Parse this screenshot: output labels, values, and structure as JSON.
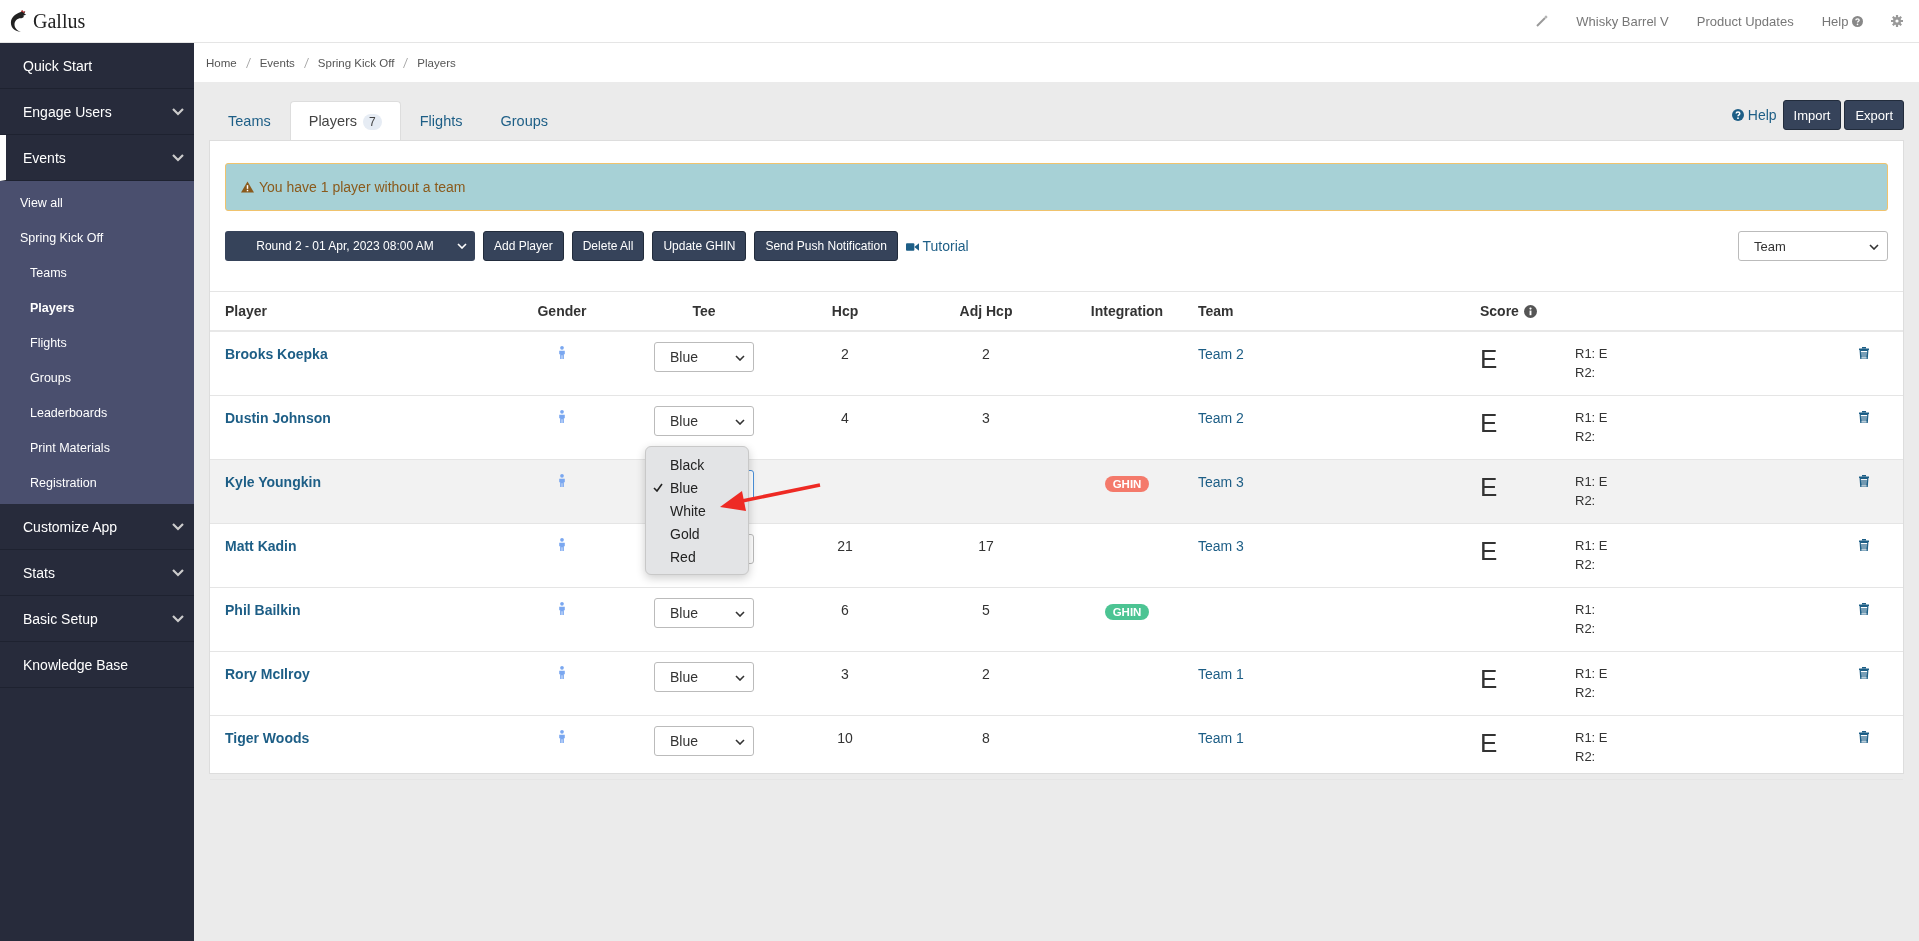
{
  "header": {
    "brand": "Gallus",
    "nav": [
      {
        "label": "Whisky Barrel V",
        "kind": "wand"
      },
      {
        "label": "Product Updates",
        "kind": "link"
      },
      {
        "label": "Help",
        "kind": "help"
      },
      {
        "kind": "settings"
      }
    ]
  },
  "sidebar": {
    "items": [
      {
        "label": "Quick Start",
        "kind": "link",
        "selected": false
      },
      {
        "label": "Engage Users",
        "kind": "group",
        "selected": false
      },
      {
        "label": "Events",
        "kind": "group",
        "selected": true,
        "children": [
          {
            "label": "View all",
            "selected": false
          },
          {
            "label": "Spring Kick Off",
            "selected": false,
            "children": [
              {
                "label": "Teams",
                "selected": false
              },
              {
                "label": "Players",
                "selected": true
              },
              {
                "label": "Flights",
                "selected": false
              },
              {
                "label": "Groups",
                "selected": false
              },
              {
                "label": "Leaderboards",
                "selected": false
              },
              {
                "label": "Print Materials",
                "selected": false
              },
              {
                "label": "Registration",
                "selected": false
              }
            ]
          }
        ]
      },
      {
        "label": "Customize App",
        "kind": "group",
        "selected": false
      },
      {
        "label": "Stats",
        "kind": "group",
        "selected": false
      },
      {
        "label": "Basic Setup",
        "kind": "group",
        "selected": false
      },
      {
        "label": "Knowledge Base",
        "kind": "link",
        "selected": false
      }
    ]
  },
  "breadcrumb": [
    "Home",
    "Events",
    "Spring Kick Off",
    "Players"
  ],
  "tabs": [
    {
      "label": "Teams",
      "selected": false
    },
    {
      "label": "Players",
      "count": "7",
      "selected": true
    },
    {
      "label": "Flights",
      "selected": false
    },
    {
      "label": "Groups",
      "selected": false
    }
  ],
  "actions": {
    "help": "Help",
    "buttons": [
      "Import",
      "Export"
    ]
  },
  "alert": "You have 1 player without a team",
  "toolbar": {
    "round_select": "Round 2 - 01 Apr, 2023 08:00 AM",
    "buttons": [
      "Add Player",
      "Delete All",
      "Update GHIN",
      "Send Push Notification"
    ],
    "tutorial": "Tutorial",
    "group_select": "Team"
  },
  "table": {
    "columns": [
      "Player",
      "Gender",
      "Tee",
      "Hcp",
      "Adj Hcp",
      "Integration",
      "Team",
      "Score"
    ],
    "rows": [
      {
        "player": "Brooks Koepka",
        "tee": "Blue",
        "hcp": "2",
        "adj_hcp": "2",
        "team": "Team 2",
        "score": "E",
        "rounds": [
          "R1: E",
          "R2:"
        ],
        "highlighted": false
      },
      {
        "player": "Dustin Johnson",
        "tee": "Blue",
        "hcp": "4",
        "adj_hcp": "3",
        "team": "Team 2",
        "score": "E",
        "rounds": [
          "R1: E",
          "R2:"
        ],
        "highlighted": false
      },
      {
        "player": "Kyle Youngkin",
        "integration": {
          "label": "GHIN",
          "color": "#f47a6b"
        },
        "team": "Team 3",
        "score": "E",
        "rounds": [
          "R1: E",
          "R2:"
        ],
        "highlighted": true,
        "tee_menu": {
          "options": [
            {
              "label": "Black",
              "selected": false
            },
            {
              "label": "Blue",
              "selected": true
            },
            {
              "label": "White",
              "selected": false
            },
            {
              "label": "Gold",
              "selected": false
            },
            {
              "label": "Red",
              "selected": false
            }
          ]
        }
      },
      {
        "player": "Matt Kadin",
        "hcp": "21",
        "adj_hcp": "17",
        "team": "Team 3",
        "score": "E",
        "rounds": [
          "R1: E",
          "R2:"
        ],
        "highlighted": false
      },
      {
        "player": "Phil Bailkin",
        "tee": "Blue",
        "hcp": "6",
        "adj_hcp": "5",
        "integration": {
          "label": "GHIN",
          "color": "#4cc493"
        },
        "rounds": [
          "R1:",
          "R2:"
        ],
        "highlighted": false
      },
      {
        "player": "Rory McIlroy",
        "tee": "Blue",
        "hcp": "3",
        "adj_hcp": "2",
        "team": "Team 1",
        "score": "E",
        "rounds": [
          "R1: E",
          "R2:"
        ],
        "highlighted": false
      },
      {
        "player": "Tiger Woods",
        "tee": "Blue",
        "hcp": "10",
        "adj_hcp": "8",
        "team": "Team 1",
        "score": "E",
        "rounds": [
          "R1: E",
          "R2:"
        ],
        "highlighted": false
      }
    ]
  }
}
